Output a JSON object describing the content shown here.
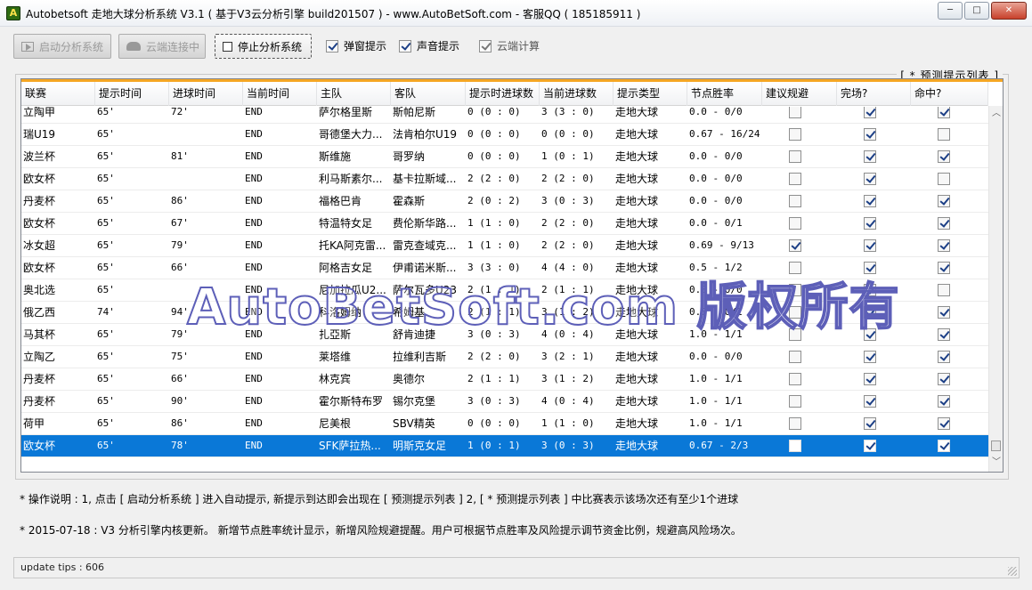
{
  "window": {
    "title": "Autobetsoft 走地大球分析系统 V3.1 ( 基于V3云分析引擎 build201507 ) - www.AutoBetSoft.com - 客服QQ ( 185185911 )",
    "icon": "A",
    "minimize_label": "─",
    "maximize_label": "□",
    "close_label": "✕"
  },
  "toolbar": {
    "start_label": "启动分析系统",
    "cloud_label": "云端连接中",
    "stop_label": "停止分析系统",
    "popup_label": "弹窗提示",
    "popup_checked": true,
    "sound_label": "声音提示",
    "sound_checked": true,
    "cloud_calc_label": "云端计算",
    "cloud_calc_checked": true
  },
  "group": {
    "title": "[ * 预测提示列表 ]"
  },
  "table": {
    "columns": [
      "联赛",
      "提示时间",
      "进球时间",
      "当前时间",
      "主队",
      "客队",
      "提示时进球数",
      "当前进球数",
      "提示类型",
      "节点胜率",
      "建议规避",
      "完场?",
      "命中?"
    ],
    "rows": [
      {
        "league": "立陶甲",
        "tip_time": "65'",
        "goal_time": "72'",
        "cur_time": "END",
        "home": "萨尔格里斯",
        "away": "斯帕尼斯",
        "tip_goals": "0 (0 : 0)",
        "cur_goals": "3 (3 : 0)",
        "type": "走地大球",
        "rate": "0.0 - 0/0",
        "avoid": false,
        "finished": true,
        "hit": true
      },
      {
        "league": "瑞U19",
        "tip_time": "65'",
        "goal_time": "",
        "cur_time": "END",
        "home": "哥德堡大力...",
        "away": "法肯柏尔U19",
        "tip_goals": "0 (0 : 0)",
        "cur_goals": "0 (0 : 0)",
        "type": "走地大球",
        "rate": "0.67 - 16/24",
        "avoid": false,
        "finished": true,
        "hit": false
      },
      {
        "league": "波兰杯",
        "tip_time": "65'",
        "goal_time": "81'",
        "cur_time": "END",
        "home": "斯维施",
        "away": "哥罗纳",
        "tip_goals": "0 (0 : 0)",
        "cur_goals": "1 (0 : 1)",
        "type": "走地大球",
        "rate": "0.0 - 0/0",
        "avoid": false,
        "finished": true,
        "hit": true
      },
      {
        "league": "欧女杯",
        "tip_time": "65'",
        "goal_time": "",
        "cur_time": "END",
        "home": "利马斯素尔...",
        "away": "基卡拉斯域...",
        "tip_goals": "2 (2 : 0)",
        "cur_goals": "2 (2 : 0)",
        "type": "走地大球",
        "rate": "0.0 - 0/0",
        "avoid": false,
        "finished": true,
        "hit": false
      },
      {
        "league": "丹麦杯",
        "tip_time": "65'",
        "goal_time": "86'",
        "cur_time": "END",
        "home": "福格巴肯",
        "away": "霍森斯",
        "tip_goals": "2 (0 : 2)",
        "cur_goals": "3 (0 : 3)",
        "type": "走地大球",
        "rate": "0.0 - 0/0",
        "avoid": false,
        "finished": true,
        "hit": true
      },
      {
        "league": "欧女杯",
        "tip_time": "65'",
        "goal_time": "67'",
        "cur_time": "END",
        "home": "特温特女足",
        "away": "费伦斯华路...",
        "tip_goals": "1 (1 : 0)",
        "cur_goals": "2 (2 : 0)",
        "type": "走地大球",
        "rate": "0.0 - 0/1",
        "avoid": false,
        "finished": true,
        "hit": true
      },
      {
        "league": "冰女超",
        "tip_time": "65'",
        "goal_time": "79'",
        "cur_time": "END",
        "home": "托KA阿克雷...",
        "away": "雷克查域克...",
        "tip_goals": "1 (1 : 0)",
        "cur_goals": "2 (2 : 0)",
        "type": "走地大球",
        "rate": "0.69 - 9/13",
        "avoid": true,
        "finished": true,
        "hit": true
      },
      {
        "league": "欧女杯",
        "tip_time": "65'",
        "goal_time": "66'",
        "cur_time": "END",
        "home": "阿格吉女足",
        "away": "伊甫诺米斯...",
        "tip_goals": "3 (3 : 0)",
        "cur_goals": "4 (4 : 0)",
        "type": "走地大球",
        "rate": "0.5 - 1/2",
        "avoid": false,
        "finished": true,
        "hit": true
      },
      {
        "league": "奥北选",
        "tip_time": "65'",
        "goal_time": "",
        "cur_time": "END",
        "home": "尼加拉瓜U2...",
        "away": "萨尔瓦多U23",
        "tip_goals": "2 (1 : 1)",
        "cur_goals": "2 (1 : 1)",
        "type": "走地大球",
        "rate": "0.0 - 0/0",
        "avoid": false,
        "finished": true,
        "hit": false
      },
      {
        "league": "俄乙西",
        "tip_time": "74'",
        "goal_time": "94'",
        "cur_time": "END",
        "home": "科洛姆纳",
        "away": "希姆基",
        "tip_goals": "2 (1 : 1)",
        "cur_goals": "3 (1 : 2)",
        "type": "走地大球",
        "rate": "0.0 - 0/1",
        "avoid": false,
        "finished": true,
        "hit": true
      },
      {
        "league": "马其杯",
        "tip_time": "65'",
        "goal_time": "79'",
        "cur_time": "END",
        "home": "扎亞斯",
        "away": "舒肯迪捷",
        "tip_goals": "3 (0 : 3)",
        "cur_goals": "4 (0 : 4)",
        "type": "走地大球",
        "rate": "1.0 - 1/1",
        "avoid": false,
        "finished": true,
        "hit": true
      },
      {
        "league": "立陶乙",
        "tip_time": "65'",
        "goal_time": "75'",
        "cur_time": "END",
        "home": "莱塔维",
        "away": "拉维利吉斯",
        "tip_goals": "2 (2 : 0)",
        "cur_goals": "3 (2 : 1)",
        "type": "走地大球",
        "rate": "0.0 - 0/0",
        "avoid": false,
        "finished": true,
        "hit": true
      },
      {
        "league": "丹麦杯",
        "tip_time": "65'",
        "goal_time": "66'",
        "cur_time": "END",
        "home": "林克宾",
        "away": "奥德尔",
        "tip_goals": "2 (1 : 1)",
        "cur_goals": "3 (1 : 2)",
        "type": "走地大球",
        "rate": "1.0 - 1/1",
        "avoid": false,
        "finished": true,
        "hit": true
      },
      {
        "league": "丹麦杯",
        "tip_time": "65'",
        "goal_time": "90'",
        "cur_time": "END",
        "home": "霍尔斯特布罗",
        "away": "锡尔克堡",
        "tip_goals": "3 (0 : 3)",
        "cur_goals": "4 (0 : 4)",
        "type": "走地大球",
        "rate": "1.0 - 1/1",
        "avoid": false,
        "finished": true,
        "hit": true
      },
      {
        "league": "荷甲",
        "tip_time": "65'",
        "goal_time": "86'",
        "cur_time": "END",
        "home": "尼美根",
        "away": "SBV精英",
        "tip_goals": "0 (0 : 0)",
        "cur_goals": "1 (1 : 0)",
        "type": "走地大球",
        "rate": "1.0 - 1/1",
        "avoid": false,
        "finished": true,
        "hit": true
      },
      {
        "league": "欧女杯",
        "tip_time": "65'",
        "goal_time": "78'",
        "cur_time": "END",
        "home": "SFK萨拉热...",
        "away": "明斯克女足",
        "tip_goals": "1 (0 : 1)",
        "cur_goals": "3 (0 : 3)",
        "type": "走地大球",
        "rate": "0.67 - 2/3",
        "avoid": false,
        "finished": true,
        "hit": true,
        "selected": true
      }
    ]
  },
  "watermark": "AutoBetSoft.com 版权所有",
  "notes": {
    "line1": "* 操作说明 : 1, 点击 [ 启动分析系统 ] 进入自动提示, 新提示到达即会出现在 [ 预测提示列表 ] 2, [ * 预测提示列表 ] 中比赛表示该场次还有至少1个进球",
    "line2": "* 2015-07-18 :  V3 分析引擎内核更新。 新增节点胜率统计显示，新增风险规避提醒。用户可根据节点胜率及风险提示调节资金比例，规避高风险场次。"
  },
  "status": {
    "text": "update tips : 606"
  },
  "colors": {
    "selection": "#0a78d7",
    "accent_line": "#f5a623",
    "watermark_stroke": "#5d5fb8"
  }
}
